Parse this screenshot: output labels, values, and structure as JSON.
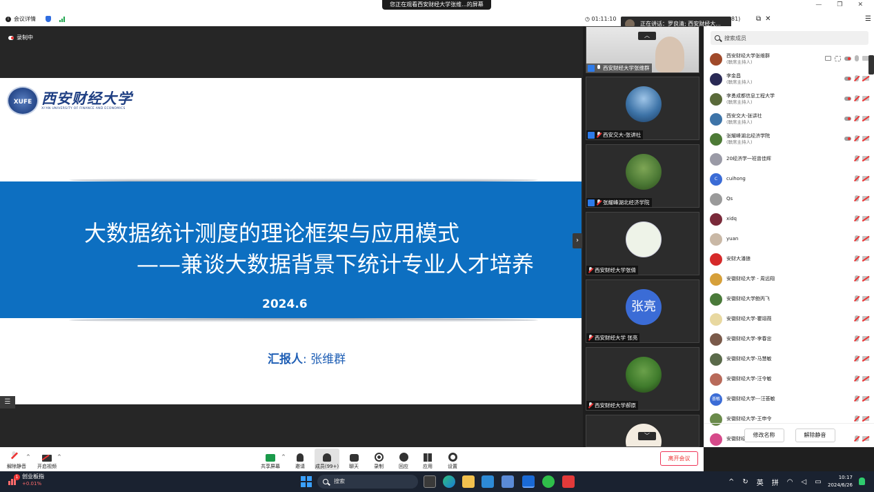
{
  "top_bar": {
    "share_banner": "您正在观看西安财经大学张维...的屏幕",
    "meeting_info_label": "会议详情",
    "timer": "01:11:10",
    "speaker_prefix": "正在讲话：罗良清; 西安财经大...",
    "panel_count_suffix": "81)"
  },
  "main": {
    "recording_label": "录制中"
  },
  "slide": {
    "logo_mark": "XUFE",
    "logo_cn": "西安财经大学",
    "logo_en": "XI'AN UNIVERSITY OF FINANCE AND ECONOMICS",
    "title_line1": "大数据统计测度的理论框架与应用模式",
    "title_line2": "——兼谈大数据背景下统计专业人才培养",
    "date": "2024.6",
    "presenter_label": "汇报人",
    "presenter_name": ": 张维群"
  },
  "videos": [
    {
      "name": "西安财经大学张维群",
      "avatar_color": "#b8b8b8"
    },
    {
      "name": "西安交大-张讲社",
      "avatar_color": "#3e74a8"
    },
    {
      "name": "张耀峰湖北经济学院",
      "avatar_color": "#4d7a36"
    },
    {
      "name": "西安财经大学张倩",
      "avatar_color": "#eef3e8"
    },
    {
      "name": "西安财经大学 张亮",
      "avatar_text": "张亮",
      "avatar_color": "#3b6cd6"
    },
    {
      "name": "西安财经大学郝原",
      "avatar_color": "#3f7b2c"
    }
  ],
  "members_panel": {
    "search_placeholder": "搜索成员",
    "members": [
      {
        "name": "西安财经大学张维群",
        "role": "(联席主持人)",
        "color": "#a04a2a"
      },
      {
        "name": "李金昌",
        "role": "(联席主持人)",
        "color": "#2a2a55"
      },
      {
        "name": "李勇成都信息工程大学",
        "role": "(联席主持人)",
        "color": "#5a6a3a"
      },
      {
        "name": "西安交大-张讲社",
        "role": "(联席主持人)",
        "color": "#3e74a8"
      },
      {
        "name": "张耀峰湖北经济学院",
        "role": "(联席主持人)",
        "color": "#4d7a36"
      },
      {
        "name": "20经济学一班曾佳辉",
        "role": "",
        "color": "#9a9aa6"
      },
      {
        "name": "cuihong",
        "role": "",
        "color": "#3b6cd6",
        "initial": "C"
      },
      {
        "name": "Qs",
        "role": "",
        "color": "#9a9a9a"
      },
      {
        "name": "xidq",
        "role": "",
        "color": "#7a2a3a"
      },
      {
        "name": "yuan",
        "role": "",
        "color": "#c9b8a6"
      },
      {
        "name": "安财大潘狼",
        "role": "",
        "color": "#d62a2a"
      },
      {
        "name": "安徽财经大学 - 周远翔",
        "role": "",
        "color": "#d6a03a"
      },
      {
        "name": "安徽财经大学鲍丙飞",
        "role": "",
        "color": "#4a7a3a"
      },
      {
        "name": "安徽财经大学-瞿翊薇",
        "role": "",
        "color": "#e8d8a0"
      },
      {
        "name": "安徽财经大学-李春忠",
        "role": "",
        "color": "#7a5a4a"
      },
      {
        "name": "安徽财经大学-马慧敏",
        "role": "",
        "color": "#5a6a4a"
      },
      {
        "name": "安徽财经大学-汪令敏",
        "role": "",
        "color": "#b86a5a"
      },
      {
        "name": "安徽财经大学---汪荟敏",
        "role": "",
        "color": "#3b6cd6",
        "initial": "荟敏"
      },
      {
        "name": "安徽财经大学-王申令",
        "role": "",
        "color": "#6a8a4a"
      },
      {
        "name": "安徽财经大学聂万军",
        "role": "",
        "color": "#d64a8a"
      }
    ],
    "rename_button": "修改名称",
    "unmute_button": "解除静音"
  },
  "toolbar": {
    "unmute": "解除静音",
    "start_video": "开启视频",
    "share_screen": "共享屏幕",
    "invite": "邀请",
    "members": "成员(99+)",
    "chat": "聊天",
    "record": "录制",
    "reactions": "回应",
    "apps": "应用",
    "settings": "设置",
    "leave": "离开会议"
  },
  "taskbar": {
    "stock_name": "创业板指",
    "stock_change": "+0.01%",
    "stock_badge": "1",
    "search_label": "搜索",
    "ime_lang": "英",
    "ime_mode": "拼",
    "time": "10:17",
    "date": "2024/6/26"
  }
}
